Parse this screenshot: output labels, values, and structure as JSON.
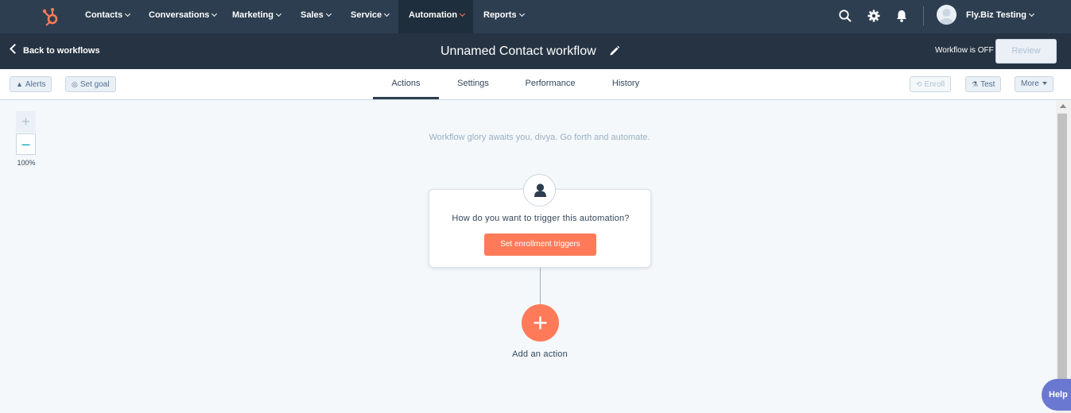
{
  "topnav": {
    "items": [
      {
        "label": "Contacts"
      },
      {
        "label": "Conversations"
      },
      {
        "label": "Marketing"
      },
      {
        "label": "Sales"
      },
      {
        "label": "Service"
      },
      {
        "label": "Automation",
        "active": true
      },
      {
        "label": "Reports"
      }
    ],
    "account_name": "Fly.Biz Testing"
  },
  "header": {
    "back_label": "Back to workflows",
    "workflow_title": "Unnamed Contact workflow",
    "status_text": "Workflow is OFF",
    "review_label": "Review"
  },
  "toolbar": {
    "alerts_label": "Alerts",
    "set_goal_label": "Set goal",
    "tabs": [
      {
        "label": "Actions",
        "active": true
      },
      {
        "label": "Settings"
      },
      {
        "label": "Performance"
      },
      {
        "label": "History"
      }
    ],
    "enroll_label": "Enroll",
    "test_label": "Test",
    "more_label": "More"
  },
  "canvas": {
    "zoom_in_symbol": "+",
    "zoom_out_symbol": "–",
    "zoom_level": "100%",
    "glory_message": "Workflow glory awaits you, divya. Go forth and automate.",
    "trigger_question": "How do you want to trigger this automation?",
    "trigger_button_label": "Set enrollment triggers",
    "add_action_label": "Add an action"
  },
  "help_label": "Help",
  "colors": {
    "nav_bg": "#2d3e50",
    "header_bg": "#253342",
    "accent_orange": "#ff7a59",
    "canvas_bg": "#f5f8fa",
    "help_purple": "#6a78d1"
  }
}
